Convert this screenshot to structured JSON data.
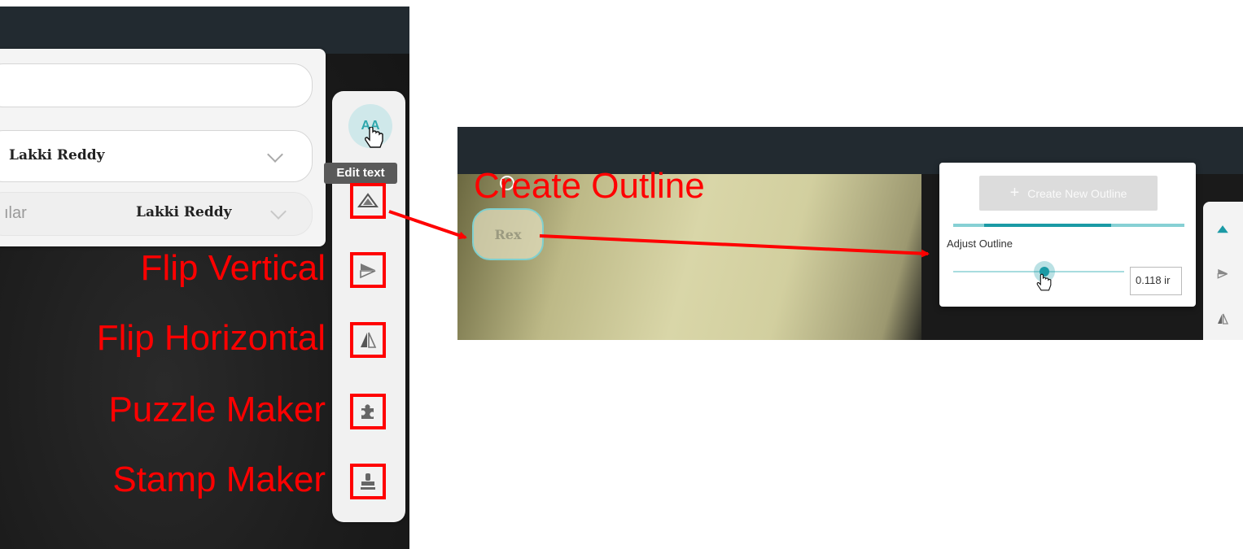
{
  "left_panel": {
    "font_selector": {
      "font_name": "Lakki Reddy",
      "style_label": "ılar",
      "style_font_preview": "Lakki Reddy"
    },
    "edit_text": {
      "glyph": "AA",
      "tooltip": "Edit text"
    },
    "tool_labels": {
      "flip_vertical": "Flip Vertical",
      "flip_horizontal": "Flip Horizontal",
      "puzzle_maker": "Puzzle Maker",
      "stamp_maker": "Stamp Maker"
    },
    "icons": {
      "create_outline": "create-outline-icon",
      "flip_vertical": "flip-vertical-icon",
      "flip_horizontal": "flip-horizontal-icon",
      "puzzle_maker": "puzzle-piece-icon",
      "stamp_maker": "stamp-icon"
    }
  },
  "right_panel": {
    "title": "Create Outline",
    "canvas_text": "Rex",
    "popup": {
      "create_button": "Create New Outline",
      "create_button_icon": "+",
      "progress_fraction": 0.55,
      "adjust_label": "Adjust Outline",
      "outline_value": "0.118 ir",
      "slider_fraction": 0.55
    }
  },
  "colors": {
    "annotation_red": "#ff0000",
    "accent_teal": "#1b9aa5",
    "topbar": "#222a30"
  }
}
